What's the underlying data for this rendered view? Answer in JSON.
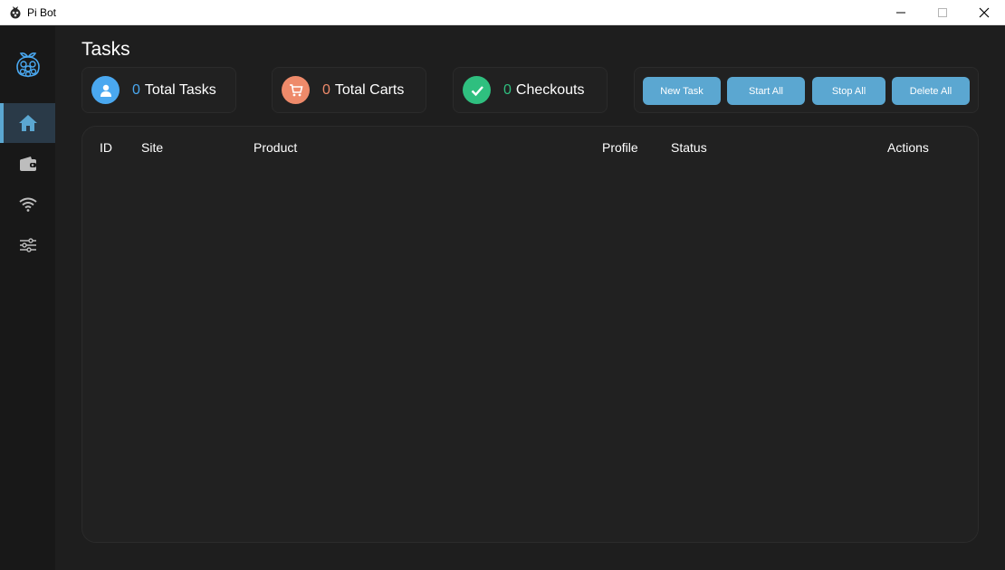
{
  "window": {
    "title": "Pi Bot"
  },
  "page": {
    "title": "Tasks"
  },
  "stats": {
    "tasks": {
      "value": "0",
      "label": "Total Tasks",
      "color": "#4aa8f0"
    },
    "carts": {
      "value": "0",
      "label": "Total Carts",
      "color": "#ee8a6a"
    },
    "checkouts": {
      "value": "0",
      "label": "Checkouts",
      "color": "#2fbf7f"
    }
  },
  "buttons": {
    "new_task": "New Task",
    "start_all": "Start All",
    "stop_all": "Stop All",
    "delete_all": "Delete All"
  },
  "table": {
    "columns": [
      "ID",
      "Site",
      "Product",
      "Profile",
      "Status",
      "Actions"
    ]
  },
  "sidebar": {
    "items": [
      {
        "icon": "home-icon",
        "active": true
      },
      {
        "icon": "wallet-icon",
        "active": false
      },
      {
        "icon": "wifi-icon",
        "active": false
      },
      {
        "icon": "sliders-icon",
        "active": false
      }
    ]
  },
  "colors": {
    "accent": "#5ba7d1",
    "background": "#1e1e1e",
    "sidebar": "#181818"
  }
}
